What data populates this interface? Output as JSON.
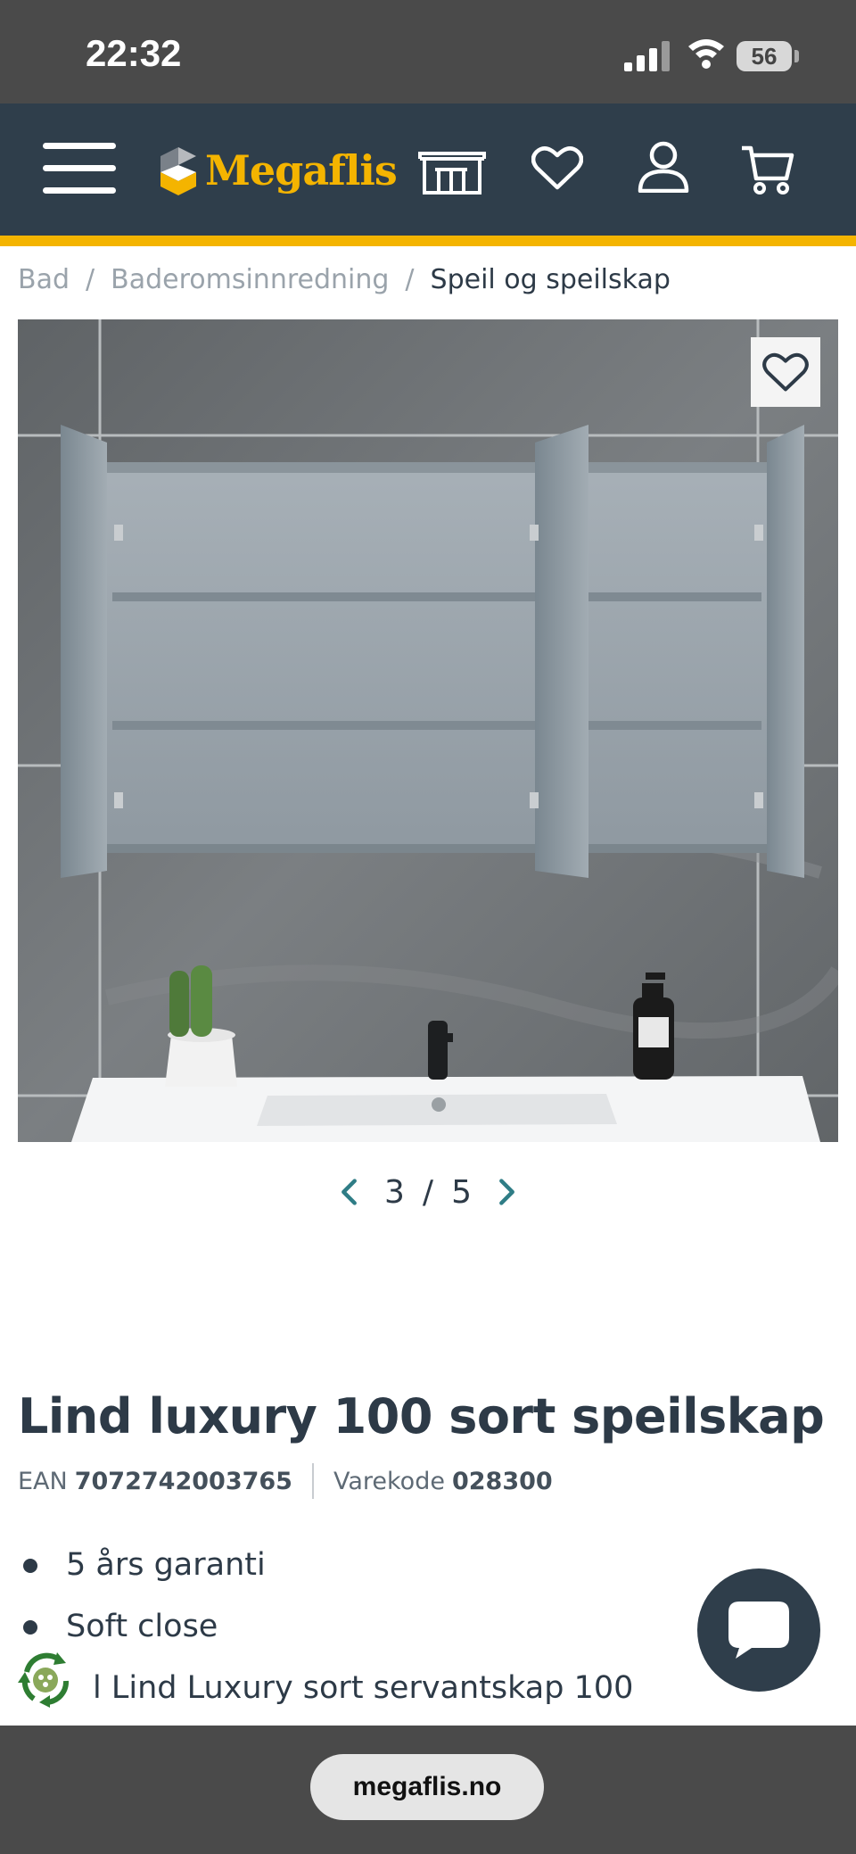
{
  "status_bar": {
    "time": "22:32",
    "battery": "56"
  },
  "header": {
    "logo_text": "Megaflis"
  },
  "breadcrumb": {
    "items": [
      "Bad",
      "Baderomsinnredning",
      "Speil og speilskap"
    ]
  },
  "gallery": {
    "current": "3",
    "separator": "/",
    "total": "5"
  },
  "product": {
    "title": "Lind luxury 100 sort speilskap",
    "ean_label": "EAN",
    "ean_value": "7072742003765",
    "code_label": "Varekode",
    "code_value": "028300",
    "features": [
      "5 års garanti",
      "Soft close",
      "l Lind Luxury sort servantskap 100"
    ]
  },
  "browser": {
    "url": "megaflis.no"
  },
  "colors": {
    "header_bg": "#2f3e4b",
    "accent": "#f4b400",
    "text": "#2d3a47",
    "teal_arrow": "#2f7d86"
  }
}
